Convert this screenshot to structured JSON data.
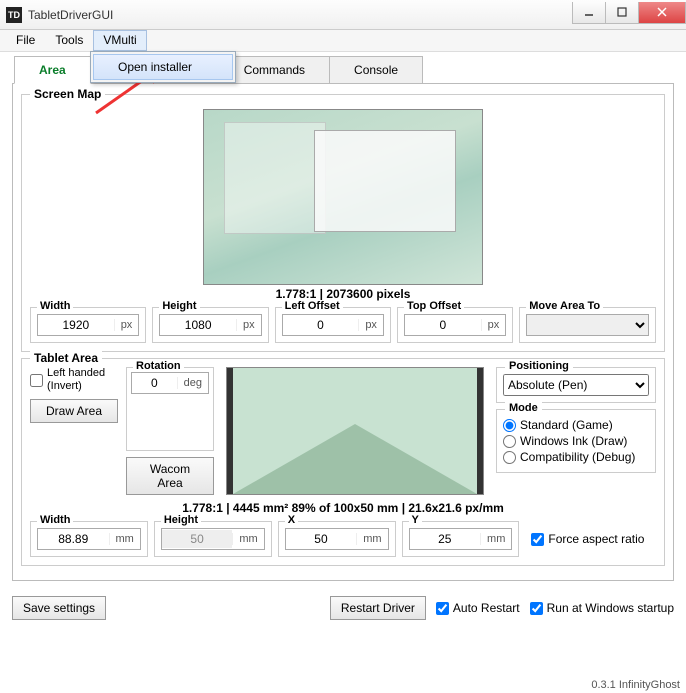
{
  "window": {
    "title": "TabletDriverGUI"
  },
  "menubar": {
    "file": "File",
    "tools": "Tools",
    "vmulti": "VMulti"
  },
  "vmulti_menu": {
    "open_installer": "Open installer"
  },
  "tabs": {
    "area": "Area",
    "commands": "Commands",
    "console": "Console"
  },
  "screenmap": {
    "group_title": "Screen Map",
    "info": "1.778:1 | 2073600 pixels",
    "width_label": "Width",
    "width_value": "1920",
    "width_unit": "px",
    "height_label": "Height",
    "height_value": "1080",
    "height_unit": "px",
    "left_label": "Left Offset",
    "left_value": "0",
    "left_unit": "px",
    "top_label": "Top Offset",
    "top_value": "0",
    "top_unit": "px",
    "move_label": "Move Area To"
  },
  "tabletarea": {
    "group_title": "Tablet Area",
    "left_handed": "Left handed (Invert)",
    "rotation_label": "Rotation",
    "rotation_value": "0",
    "rotation_unit": "deg",
    "draw_area": "Draw Area",
    "wacom_area": "Wacom Area",
    "positioning_label": "Positioning",
    "positioning_value": "Absolute (Pen)",
    "mode_label": "Mode",
    "mode_std": "Standard (Game)",
    "mode_ink": "Windows Ink (Draw)",
    "mode_compat": "Compatibility (Debug)",
    "info": "1.778:1 | 4445 mm² 89% of 100x50 mm | 21.6x21.6 px/mm",
    "width_label": "Width",
    "width_value": "88.89",
    "width_unit": "mm",
    "height_label": "Height",
    "height_value": "50",
    "height_unit": "mm",
    "x_label": "X",
    "x_value": "50",
    "x_unit": "mm",
    "y_label": "Y",
    "y_value": "25",
    "y_unit": "mm",
    "force_ratio": "Force aspect ratio"
  },
  "bottom": {
    "save": "Save settings",
    "restart": "Restart Driver",
    "auto_restart": "Auto Restart",
    "run_startup": "Run at Windows startup"
  },
  "status": "0.3.1 InfinityGhost"
}
